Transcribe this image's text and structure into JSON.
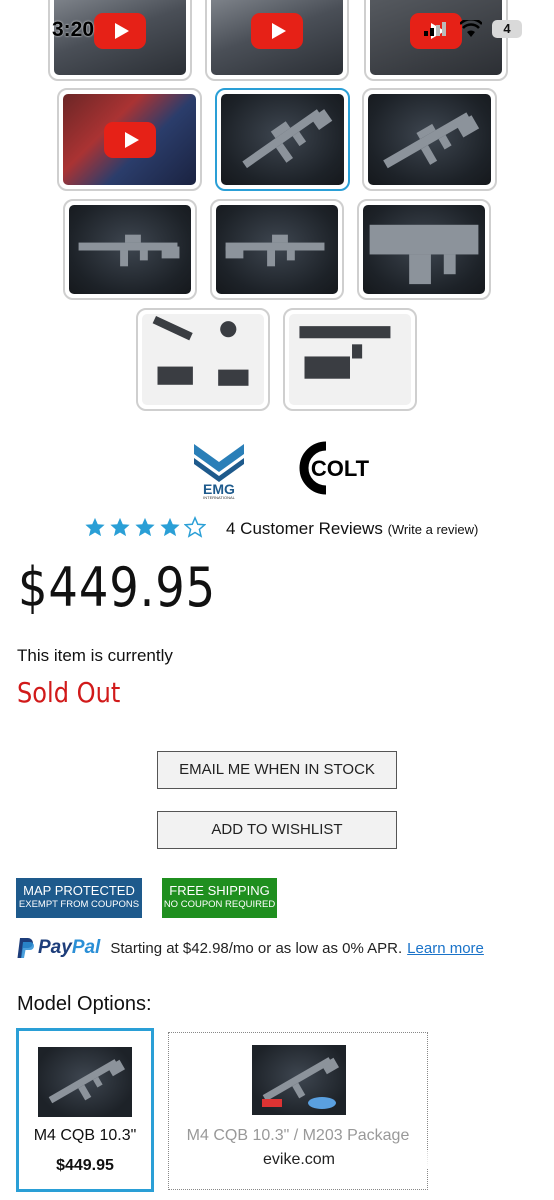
{
  "status_bar": {
    "time": "3:20",
    "battery": "4"
  },
  "brands": {
    "emg_text": "EMG",
    "emg_sub": "INTERNATIONAL",
    "colt_text": "COLT"
  },
  "rating": {
    "stars": 4,
    "max": 5,
    "reviews_label": "4 Customer Reviews",
    "write_review": "(Write a review)"
  },
  "price": "$449.95",
  "availability": {
    "label": "This item is currently",
    "status": "Sold Out"
  },
  "buttons": {
    "email_stock": "EMAIL ME WHEN IN STOCK",
    "wishlist": "ADD TO WISHLIST"
  },
  "badges": {
    "map": {
      "line1": "MAP PROTECTED",
      "line2": "EXEMPT FROM COUPONS",
      "color": "#1e5a8c"
    },
    "shipping": {
      "line1": "FREE SHIPPING",
      "line2": "NO COUPON REQUIRED",
      "color": "#1f8f1f"
    }
  },
  "paypal": {
    "brand_pay": "Pay",
    "brand_pal": "Pal",
    "text": "Starting at $42.98/mo or as low as 0% APR.",
    "link": "Learn more"
  },
  "model_options": {
    "title": "Model Options:",
    "options": [
      {
        "name": "M4 CQB 10.3\"",
        "price": "$449.95",
        "selected": true
      },
      {
        "name": "M4 CQB 10.3\" / M203 Package",
        "watermark": "evike.com",
        "selected": false
      }
    ]
  },
  "colors": {
    "accent": "#2a9fd6",
    "sold_out": "#d11a1a",
    "link": "#1a73c9"
  }
}
